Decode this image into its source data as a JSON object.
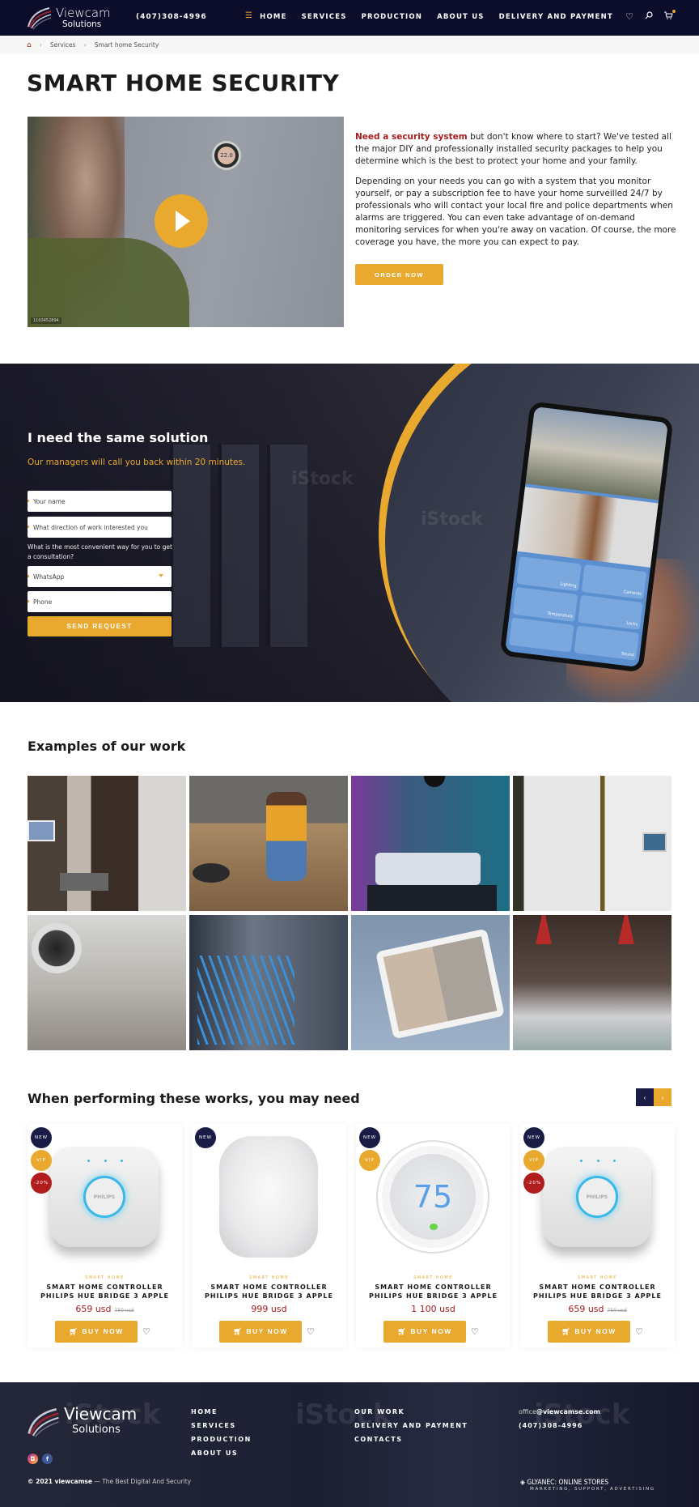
{
  "header": {
    "logo_line1": "Viewcam",
    "logo_line2": "Solutions",
    "phone": "(407)308-4996",
    "nav": [
      "HOME",
      "SERVICES",
      "PRODUCTION",
      "ABOUT US",
      "DELIVERY AND PAYMENT"
    ],
    "icons": [
      "heart-icon",
      "search-icon",
      "cart-icon"
    ]
  },
  "breadcrumb": [
    "Services",
    "Smart home Security"
  ],
  "page_title": "SMART HOME SECURITY",
  "video": {
    "stock_id": "1103452894",
    "thermostat_reading": "22.0"
  },
  "intro": {
    "highlight": "Need a security system",
    "p1_rest": " but don't know where to start? We've tested all the major DIY and professionally installed security packages to help you determine which is the best to protect your home and your family.",
    "p2": "Depending on your needs you can go with a system that you monitor yourself, or pay a subscription fee to have your home surveilled 24/7 by professionals who will contact your local fire and police departments when alarms are triggered. You can even take advantage of on-demand monitoring services for when you're away on vacation. Of course, the more coverage you have, the more you can expect to pay.",
    "order_button": "ORDER NOW"
  },
  "request_form": {
    "title": "I need the same solution",
    "subtitle": "Our managers will call you back within 20 minutes.",
    "name_placeholder": "Your name",
    "direction_placeholder": "What direction of work interested you",
    "question": "What is the most convenient way for you to get a consultation?",
    "contact_method": "WhatsApp",
    "phone_placeholder": "Phone",
    "send_button": "SEND REQUEST",
    "phone_tiles": [
      "Lighting",
      "Cameras",
      "Temperature",
      "Locks",
      "",
      "Sound"
    ]
  },
  "examples": {
    "title": "Examples of our work",
    "images": [
      "Modern living room with wall control panel",
      "Woman on floor with robot vacuum",
      "Living room with purple and blue lighting",
      "White hallway with wall panel",
      "Ceiling dome security camera",
      "Server rack with blue network cables",
      "Tablet showing camera feeds",
      "Kitchen with red pendant lamps"
    ]
  },
  "products": {
    "title": "When performing these works, you may need",
    "prev_label": "‹",
    "next_label": "›",
    "items": [
      {
        "badges": [
          "NEW",
          "VIP",
          "-20%"
        ],
        "category": "SMART HOME",
        "name_line1": "SMART HOME CONTROLLER",
        "name_line2": "PHILIPS HUE BRIDGE 3 APPLE",
        "price": "659 usd",
        "old_price": "750 usd",
        "image": "hue",
        "buy": "BUY NOW"
      },
      {
        "badges": [
          "NEW"
        ],
        "category": "SMART HOME",
        "name_line1": "SMART HOME CONTROLLER",
        "name_line2": "PHILIPS HUE BRIDGE 3 APPLE",
        "price": "999 usd",
        "old_price": "",
        "image": "pod",
        "buy": "BUY NOW"
      },
      {
        "badges": [
          "NEW",
          "VIP"
        ],
        "category": "SMART HOME",
        "name_line1": "SMART HOME CONTROLLER",
        "name_line2": "PHILIPS HUE BRIDGE 3 APPLE",
        "price": "1 100 usd",
        "old_price": "",
        "image": "nest",
        "buy": "BUY NOW",
        "nest_value": "75"
      },
      {
        "badges": [
          "NEW",
          "VIP",
          "-20%"
        ],
        "category": "SMART HOME",
        "name_line1": "SMART HOME CONTROLLER",
        "name_line2": "PHILIPS HUE BRIDGE 3 APPLE",
        "price": "659 usd",
        "old_price": "750 usd",
        "image": "hue",
        "buy": "BUY NOW"
      }
    ],
    "hue_brand": "PHILIPS"
  },
  "footer": {
    "logo_line1": "Viewcam",
    "logo_line2": "Solutions",
    "nav_col1": [
      "HOME",
      "SERVICES",
      "PRODUCTION",
      "ABOUT US"
    ],
    "nav_col2": [
      "OUR WORK",
      "DELIVERY AND PAYMENT",
      "CONTACTS"
    ],
    "email_prefix": "office",
    "email_domain": "@viewcamse.com",
    "phone": "(407)308-4996",
    "copyright_bold": "© 2021 viewcamse",
    "copyright_rest": " — The Best Digital And Security",
    "credit_line1": "GLYANEC: ONLINE STORES",
    "credit_line2": "MARKETING, SUPPORT, ADVERTISING"
  },
  "colors": {
    "navy": "#0c0d2a",
    "accent": "#e9a92f",
    "red": "#a51d1d"
  }
}
